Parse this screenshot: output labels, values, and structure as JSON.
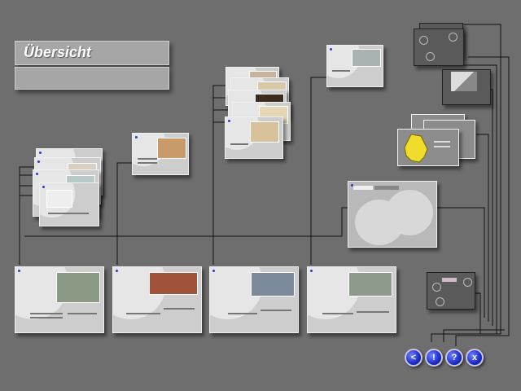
{
  "header": {
    "title": "Übersicht"
  },
  "nav": {
    "back_label": "<",
    "info_label": "!",
    "help_label": "?",
    "close_label": "x"
  },
  "colors": {
    "background": "#6e6e6e",
    "accent": "#1b2ac9"
  }
}
